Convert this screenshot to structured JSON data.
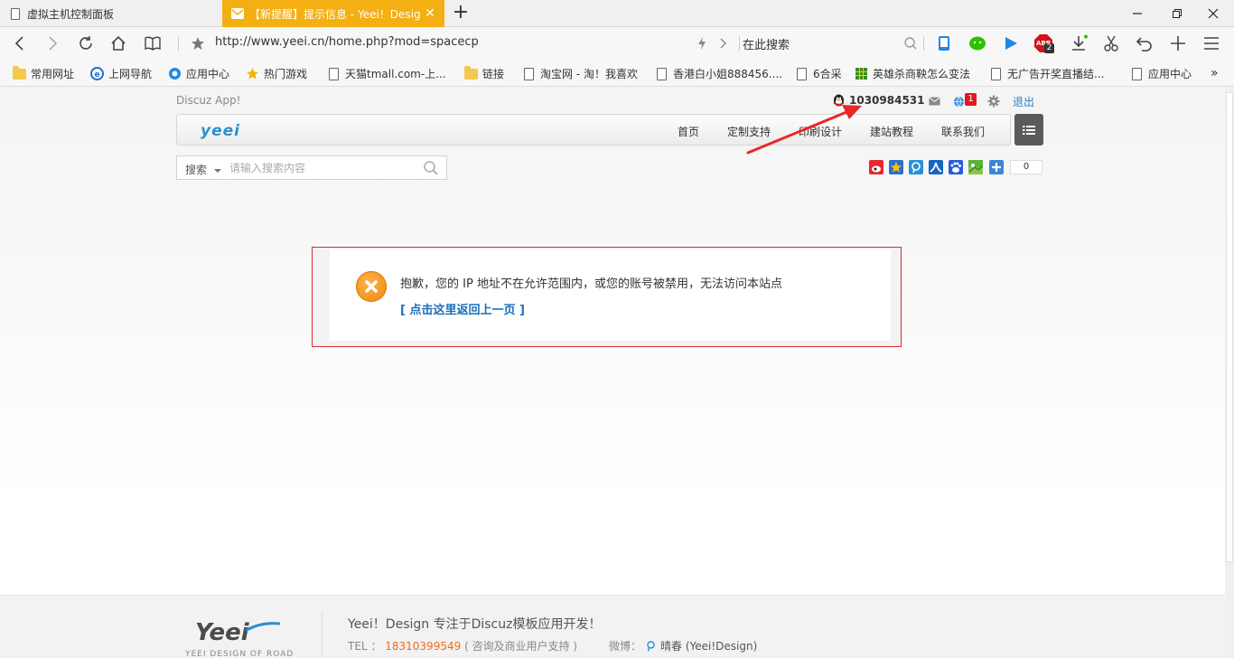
{
  "browser": {
    "tabs": [
      {
        "title": "虚拟主机控制面板",
        "active": false
      },
      {
        "title": "【新提醒】提示信息 - Yeei！Design",
        "active": true,
        "close": "✕"
      }
    ],
    "address": "http://www.yeei.cn/home.php?mod=spacecp",
    "search_placeholder": "在此搜索",
    "bookmarks": [
      {
        "label": "常用网址",
        "icon": "folder-icon"
      },
      {
        "label": "上网导航",
        "icon": "ie-icon"
      },
      {
        "label": "应用中心",
        "icon": "app-icon"
      },
      {
        "label": "热门游戏",
        "icon": "star-icon"
      },
      {
        "label": "天猫tmall.com-上...",
        "icon": "doc-icon"
      },
      {
        "label": "链接",
        "icon": "folder-icon"
      },
      {
        "label": "淘宝网 - 淘！我喜欢",
        "icon": "doc-icon"
      },
      {
        "label": "香港白小姐888456....",
        "icon": "doc-icon"
      },
      {
        "label": "6合采",
        "icon": "doc-icon"
      },
      {
        "label": "英雄杀商鞅怎么变法",
        "icon": "grid-icon"
      },
      {
        "label": "无广告开奖直播结...",
        "icon": "doc-icon"
      },
      {
        "label": "应用中心",
        "icon": "doc-icon"
      }
    ],
    "more_bookmarks": "»",
    "adblock_count": "2"
  },
  "site": {
    "app_link": "Discuz App!",
    "username": "1030984531",
    "notice_count": "1",
    "logout": "退出",
    "logo": "yeei",
    "nav": [
      {
        "label": "首页"
      },
      {
        "label": "定制支持"
      },
      {
        "label": "印刷设计"
      },
      {
        "label": "建站教程"
      },
      {
        "label": "联系我们"
      }
    ],
    "search": {
      "type": "搜索",
      "placeholder": "请输入搜索内容"
    },
    "share_count": "0"
  },
  "alert": {
    "message": "抱歉，您的 IP 地址不在允许范围内，或您的账号被禁用，无法访问本站点",
    "back_link": "[ 点击这里返回上一页 ]"
  },
  "footer": {
    "logo": "Yeei",
    "logo_sub": "YEEI DESIGN OF ROAD",
    "slogan": "Yeei！Design 专注于Discuz模板应用开发！",
    "tel_label": "TEL ：",
    "tel": "18310399549",
    "tel_note": "( 咨询及商业用户支持 )",
    "weibo_label": "微博：",
    "weibo_name": "晴春 (Yeei!Design)"
  },
  "colors": {
    "accent_tab": "#f4b013",
    "alert_border": "#e0282e",
    "link": "#1a6fb8",
    "tel": "#f26c1b"
  }
}
